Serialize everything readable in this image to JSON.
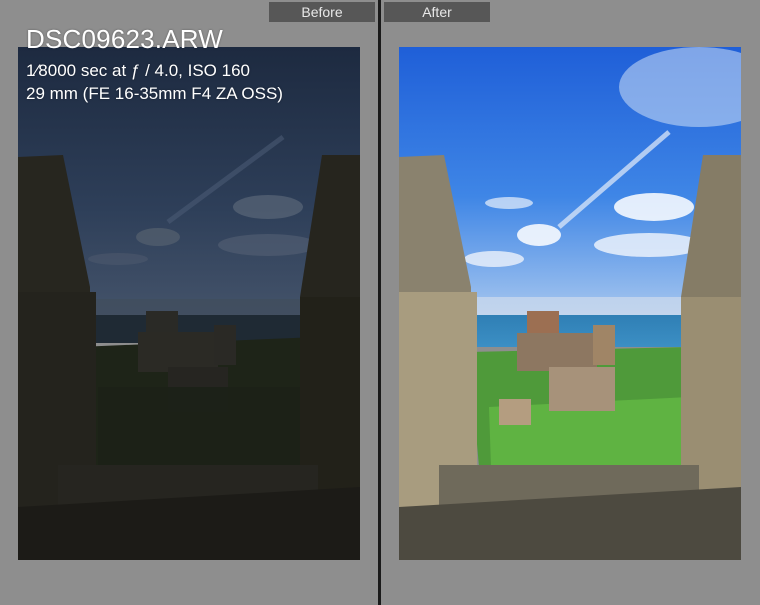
{
  "compare": {
    "before_label": "Before",
    "after_label": "After"
  },
  "info_overlay": {
    "filename": "DSC09623.ARW",
    "exposure": "1⁄8000 sec at ƒ / 4.0, ISO 160",
    "lens": "29 mm (FE 16-35mm F4 ZA OSS)"
  },
  "colors": {
    "panel_bg": "#8e8e8e",
    "tab_bg": "#575757",
    "divider": "#1a1a1a"
  }
}
